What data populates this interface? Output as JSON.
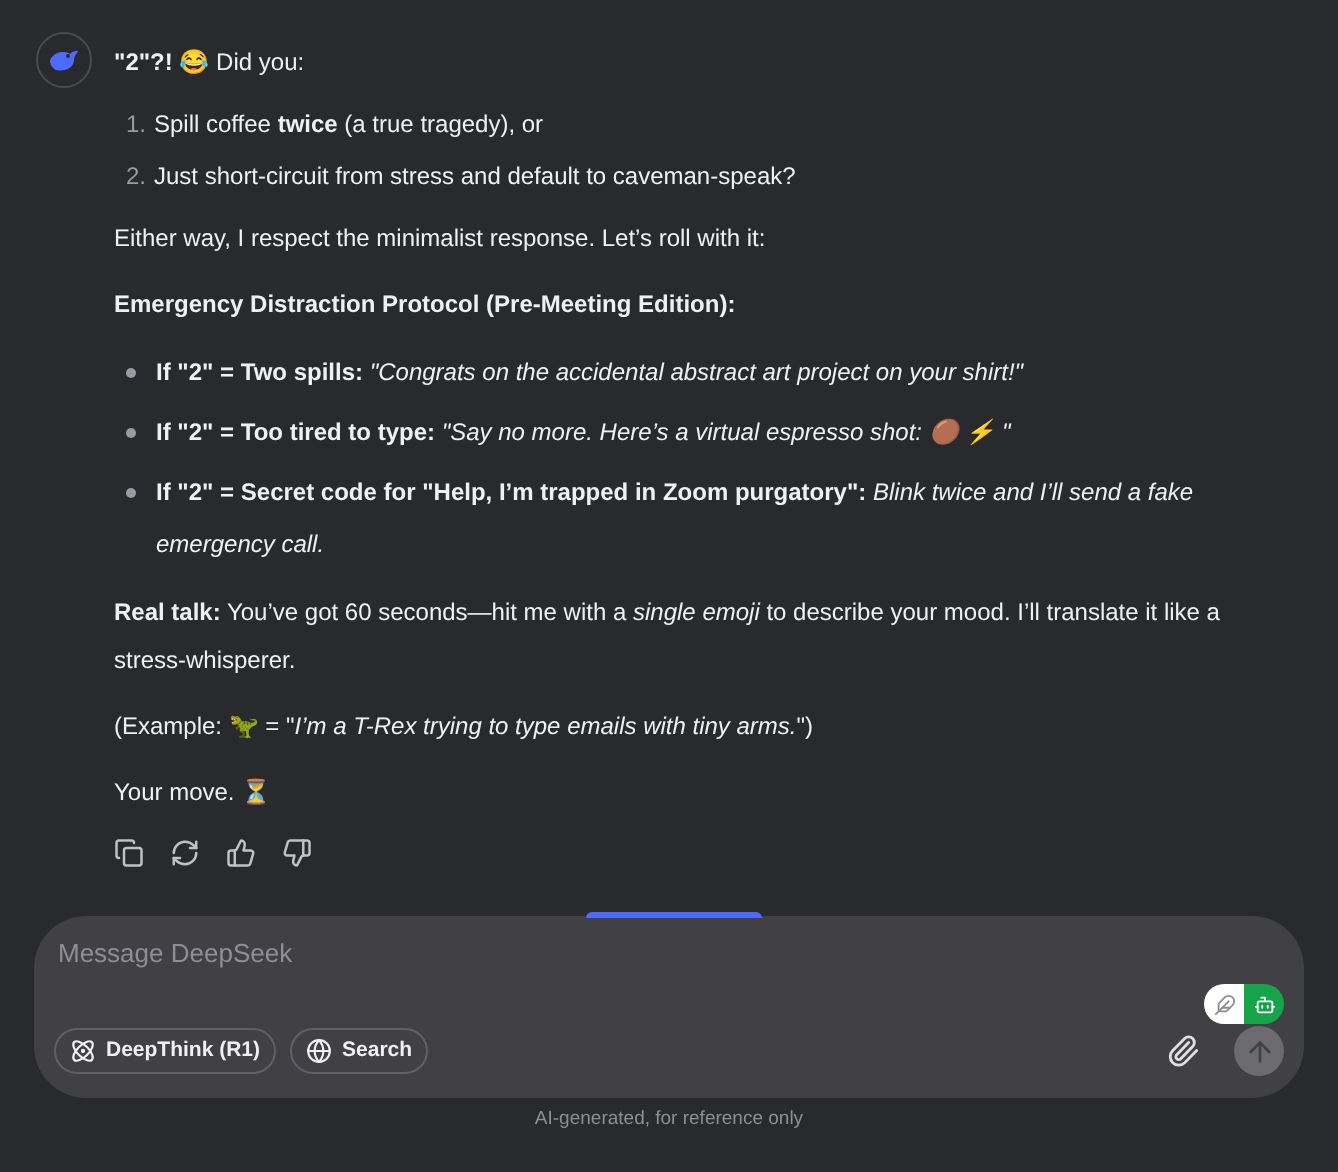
{
  "message": {
    "blocks": [
      {
        "kind": "paragraph",
        "text": "**\"2\"?!** 😂 Did you:"
      },
      {
        "kind": "ordered_list",
        "items": [
          {
            "number": "1.",
            "text": "Spill coffee **twice** (a true tragedy), or"
          },
          {
            "number": "2.",
            "text": "Just short-circuit from stress and default to caveman-speak?"
          }
        ]
      },
      {
        "kind": "paragraph",
        "text": "Either way, I respect the minimalist response. Let’s roll with it:"
      },
      {
        "kind": "paragraph",
        "text": "**Emergency Distraction Protocol (Pre-Meeting Edition):**"
      },
      {
        "kind": "bullet_list",
        "items": [
          "**If \"2\" = Two spills:** *\"Congrats on the accidental abstract art project on your shirt!\"*",
          "**If \"2\" = Too tired to type:** *\"Say no more. Here’s a virtual espresso shot: 🟤 ⚡ \"*",
          "**If \"2\" = Secret code for \"Help, I’m trapped in Zoom purgatory\":** *Blink twice and I’ll send a fake emergency call.*"
        ]
      },
      {
        "kind": "paragraph",
        "text": "**Real talk:** You’ve got 60 seconds—hit me with a *single emoji* to describe your mood. I’ll translate it like a stress-whisperer."
      },
      {
        "kind": "paragraph",
        "text": "(Example: 🦖 = \"*I’m a T-Rex trying to type emails with tiny arms.*\")"
      },
      {
        "kind": "paragraph",
        "text": "Your move. ⏳"
      }
    ]
  },
  "actions": [
    {
      "kind": "copy"
    },
    {
      "kind": "regenerate"
    },
    {
      "kind": "like"
    },
    {
      "kind": "dislike"
    }
  ],
  "composer": {
    "placeholder": "Message DeepSeek",
    "mode_toggle": [
      {
        "kind": "feather",
        "selected": false
      },
      {
        "kind": "robot",
        "selected": true
      }
    ],
    "chips": [
      {
        "kind": "deepthink",
        "label": "DeepThink (R1)",
        "selected": false
      },
      {
        "kind": "search",
        "label": "Search",
        "selected": false
      }
    ]
  },
  "footer": "AI-generated, for reference only"
}
